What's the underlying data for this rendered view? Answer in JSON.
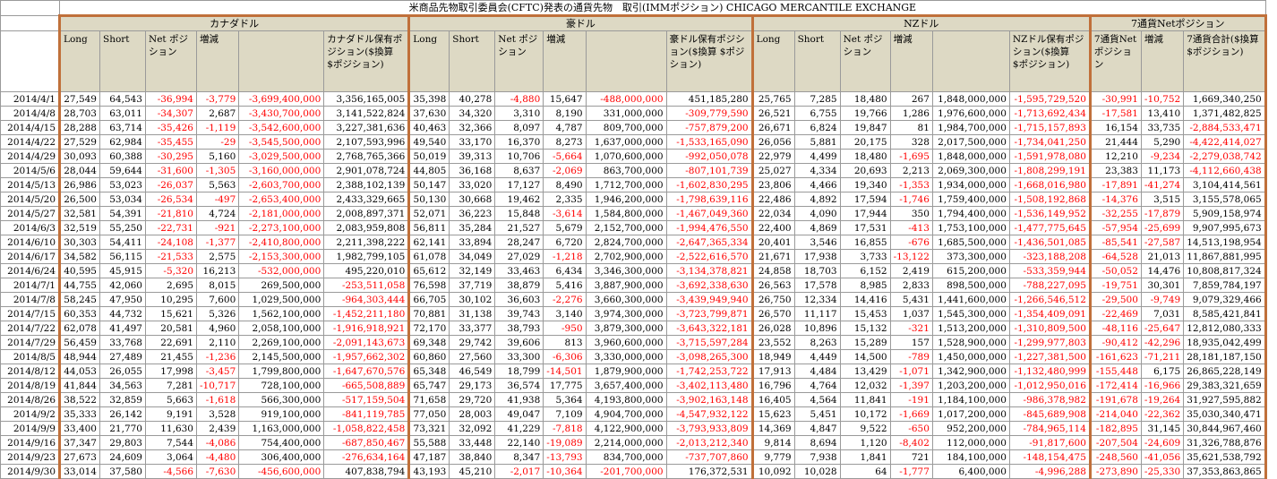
{
  "title": "米商品先物取引委員会(CFTC)発表の通貨先物　取引(IMMポジション) CHICAGO MERCANTILE EXCHANGE",
  "groups": {
    "cad": "カナダドル",
    "aud": "豪ドル",
    "nzd": "NZドル",
    "net7": "7通貨Netポジション"
  },
  "headers": {
    "cad": [
      "Long",
      "Short",
      "Net ポジション",
      "増減",
      "",
      "カナダドル保有ポジション($換算 $ポジション)"
    ],
    "aud": [
      "Long",
      "Short",
      "Net ポジション",
      "増減",
      "",
      "豪ドル保有ポジション($換算 $ポジション)"
    ],
    "nzd": [
      "Long",
      "Short",
      "Net ポジション",
      "増減",
      "",
      "NZドル保有ポジション($換算 $ポジション)"
    ],
    "net7": [
      "7通貨Net ポジション",
      "増減",
      "7通貨合計($換算 $ポジション)"
    ]
  },
  "colors": {
    "header_bg": "#ddd9c4",
    "negative": "#ff0000",
    "separator": "#c0703a"
  },
  "rows": [
    [
      "2014/4/1",
      "27,549",
      "64,543",
      "-36,994",
      "-3,779",
      "-3,699,400,000",
      "3,356,165,005",
      "35,398",
      "40,278",
      "-4,880",
      "15,647",
      "-488,000,000",
      "451,185,280",
      "25,765",
      "7,285",
      "18,480",
      "267",
      "1,848,000,000",
      "-1,595,729,520",
      "-30,991",
      "-10,752",
      "1,669,340,250"
    ],
    [
      "2014/4/8",
      "28,703",
      "63,011",
      "-34,307",
      "2,687",
      "-3,430,700,000",
      "3,141,522,824",
      "37,630",
      "34,320",
      "3,310",
      "8,190",
      "331,000,000",
      "-309,779,590",
      "26,521",
      "6,755",
      "19,766",
      "1,286",
      "1,976,600,000",
      "-1,713,692,434",
      "-17,581",
      "13,410",
      "1,371,482,825"
    ],
    [
      "2014/4/15",
      "28,288",
      "63,714",
      "-35,426",
      "-1,119",
      "-3,542,600,000",
      "3,227,381,636",
      "40,463",
      "32,366",
      "8,097",
      "4,787",
      "809,700,000",
      "-757,879,200",
      "26,671",
      "6,824",
      "19,847",
      "81",
      "1,984,700,000",
      "-1,715,157,893",
      "16,154",
      "33,735",
      "-2,884,533,471"
    ],
    [
      "2014/4/22",
      "27,529",
      "62,984",
      "-35,455",
      "-29",
      "-3,545,500,000",
      "2,107,593,996",
      "49,540",
      "33,170",
      "16,370",
      "8,273",
      "1,637,000,000",
      "-1,533,165,090",
      "26,056",
      "5,881",
      "20,175",
      "328",
      "2,017,500,000",
      "-1,734,041,250",
      "21,444",
      "5,290",
      "-4,422,414,027"
    ],
    [
      "2014/4/29",
      "30,093",
      "60,388",
      "-30,295",
      "5,160",
      "-3,029,500,000",
      "2,768,765,366",
      "50,019",
      "39,313",
      "10,706",
      "-5,664",
      "1,070,600,000",
      "-992,050,078",
      "22,979",
      "4,499",
      "18,480",
      "-1,695",
      "1,848,000,000",
      "-1,591,978,080",
      "12,210",
      "-9,234",
      "-2,279,038,742"
    ],
    [
      "2014/5/6",
      "28,044",
      "59,644",
      "-31,600",
      "-1,305",
      "-3,160,000,000",
      "2,901,078,724",
      "44,805",
      "36,168",
      "8,637",
      "-2,069",
      "863,700,000",
      "-807,101,739",
      "25,027",
      "4,334",
      "20,693",
      "2,213",
      "2,069,300,000",
      "-1,808,299,191",
      "23,383",
      "11,173",
      "-4,112,660,438"
    ],
    [
      "2014/5/13",
      "26,986",
      "53,023",
      "-26,037",
      "5,563",
      "-2,603,700,000",
      "2,388,102,139",
      "50,147",
      "33,020",
      "17,127",
      "8,490",
      "1,712,700,000",
      "-1,602,830,295",
      "23,806",
      "4,466",
      "19,340",
      "-1,353",
      "1,934,000,000",
      "-1,668,016,980",
      "-17,891",
      "-41,274",
      "3,104,414,561"
    ],
    [
      "2014/5/20",
      "26,500",
      "53,034",
      "-26,534",
      "-497",
      "-2,653,400,000",
      "2,433,329,665",
      "50,130",
      "30,668",
      "19,462",
      "2,335",
      "1,946,200,000",
      "-1,798,639,116",
      "22,486",
      "4,892",
      "17,594",
      "-1,746",
      "1,759,400,000",
      "-1,508,192,868",
      "-14,376",
      "3,515",
      "3,155,578,065"
    ],
    [
      "2014/5/27",
      "32,581",
      "54,391",
      "-21,810",
      "4,724",
      "-2,181,000,000",
      "2,008,897,371",
      "52,071",
      "36,223",
      "15,848",
      "-3,614",
      "1,584,800,000",
      "-1,467,049,360",
      "22,034",
      "4,090",
      "17,944",
      "350",
      "1,794,400,000",
      "-1,536,149,952",
      "-32,255",
      "-17,879",
      "5,909,158,974"
    ],
    [
      "2014/6/3",
      "32,519",
      "55,250",
      "-22,731",
      "-921",
      "-2,273,100,000",
      "2,083,959,808",
      "56,811",
      "35,284",
      "21,527",
      "5,679",
      "2,152,700,000",
      "-1,994,476,550",
      "22,400",
      "4,869",
      "17,531",
      "-413",
      "1,753,100,000",
      "-1,477,775,645",
      "-57,954",
      "-25,699",
      "9,907,995,673"
    ],
    [
      "2014/6/10",
      "30,303",
      "54,411",
      "-24,108",
      "-1,377",
      "-2,410,800,000",
      "2,211,398,222",
      "62,141",
      "33,894",
      "28,247",
      "6,720",
      "2,824,700,000",
      "-2,647,365,334",
      "20,401",
      "3,546",
      "16,855",
      "-676",
      "1,685,500,000",
      "-1,436,501,085",
      "-85,541",
      "-27,587",
      "14,513,198,954"
    ],
    [
      "2014/6/17",
      "34,582",
      "56,115",
      "-21,533",
      "2,575",
      "-2,153,300,000",
      "1,982,799,105",
      "61,078",
      "34,049",
      "27,029",
      "-1,218",
      "2,702,900,000",
      "-2,522,616,570",
      "21,671",
      "17,938",
      "3,733",
      "-13,122",
      "373,300,000",
      "-323,188,208",
      "-64,528",
      "21,013",
      "11,867,881,995"
    ],
    [
      "2014/6/24",
      "40,595",
      "45,915",
      "-5,320",
      "16,213",
      "-532,000,000",
      "495,220,010",
      "65,612",
      "32,149",
      "33,463",
      "6,434",
      "3,346,300,000",
      "-3,134,378,821",
      "24,858",
      "18,703",
      "6,152",
      "2,419",
      "615,200,000",
      "-533,359,944",
      "-50,052",
      "14,476",
      "10,808,817,324"
    ],
    [
      "2014/7/1",
      "44,755",
      "42,060",
      "2,695",
      "8,015",
      "269,500,000",
      "-253,511,058",
      "76,598",
      "37,719",
      "38,879",
      "5,416",
      "3,887,900,000",
      "-3,692,338,630",
      "26,563",
      "17,578",
      "8,985",
      "2,833",
      "898,500,000",
      "-788,227,095",
      "-19,751",
      "30,301",
      "7,859,784,197"
    ],
    [
      "2014/7/8",
      "58,245",
      "47,950",
      "10,295",
      "7,600",
      "1,029,500,000",
      "-964,303,444",
      "66,705",
      "30,102",
      "36,603",
      "-2,276",
      "3,660,300,000",
      "-3,439,949,940",
      "26,750",
      "12,334",
      "14,416",
      "5,431",
      "1,441,600,000",
      "-1,266,546,512",
      "-29,500",
      "-9,749",
      "9,079,329,466"
    ],
    [
      "2014/7/15",
      "60,353",
      "44,732",
      "15,621",
      "5,326",
      "1,562,100,000",
      "-1,452,211,180",
      "70,881",
      "31,138",
      "39,743",
      "3,140",
      "3,974,300,000",
      "-3,723,799,871",
      "26,570",
      "11,117",
      "15,453",
      "1,037",
      "1,545,300,000",
      "-1,354,409,091",
      "-22,469",
      "7,031",
      "8,585,421,841"
    ],
    [
      "2014/7/22",
      "62,078",
      "41,497",
      "20,581",
      "4,960",
      "2,058,100,000",
      "-1,916,918,921",
      "72,170",
      "33,377",
      "38,793",
      "-950",
      "3,879,300,000",
      "-3,643,322,181",
      "26,028",
      "10,896",
      "15,132",
      "-321",
      "1,513,200,000",
      "-1,310,809,500",
      "-48,116",
      "-25,647",
      "12,812,080,333"
    ],
    [
      "2014/7/29",
      "56,459",
      "33,768",
      "22,691",
      "2,110",
      "2,269,100,000",
      "-2,091,143,673",
      "69,348",
      "29,742",
      "39,606",
      "813",
      "3,960,600,000",
      "-3,715,597,284",
      "23,552",
      "8,263",
      "15,289",
      "157",
      "1,528,900,000",
      "-1,299,977,803",
      "-90,412",
      "-42,296",
      "18,935,042,499"
    ],
    [
      "2014/8/5",
      "48,944",
      "27,489",
      "21,455",
      "-1,236",
      "2,145,500,000",
      "-1,957,662,302",
      "60,860",
      "27,560",
      "33,300",
      "-6,306",
      "3,330,000,000",
      "-3,098,265,300",
      "18,949",
      "4,449",
      "14,500",
      "-789",
      "1,450,000,000",
      "-1,227,381,500",
      "-161,623",
      "-71,211",
      "28,181,187,150"
    ],
    [
      "2014/8/12",
      "44,053",
      "26,055",
      "17,998",
      "-3,457",
      "1,799,800,000",
      "-1,647,670,576",
      "65,348",
      "46,549",
      "18,799",
      "-14,501",
      "1,879,900,000",
      "-1,742,253,722",
      "17,913",
      "4,484",
      "13,429",
      "-1,071",
      "1,342,900,000",
      "-1,132,480,999",
      "-155,448",
      "6,175",
      "26,865,228,149"
    ],
    [
      "2014/8/19",
      "41,844",
      "34,563",
      "7,281",
      "-10,717",
      "728,100,000",
      "-665,508,889",
      "65,747",
      "29,173",
      "36,574",
      "17,775",
      "3,657,400,000",
      "-3,402,113,480",
      "16,796",
      "4,764",
      "12,032",
      "-1,397",
      "1,203,200,000",
      "-1,012,950,016",
      "-172,414",
      "-16,966",
      "29,383,321,659"
    ],
    [
      "2014/8/26",
      "38,522",
      "32,859",
      "5,663",
      "-1,618",
      "566,300,000",
      "-517,159,504",
      "71,658",
      "29,720",
      "41,938",
      "5,364",
      "4,193,800,000",
      "-3,902,163,148",
      "16,405",
      "4,564",
      "11,841",
      "-191",
      "1,184,100,000",
      "-986,378,982",
      "-191,678",
      "-19,264",
      "31,927,595,882"
    ],
    [
      "2014/9/2",
      "35,333",
      "26,142",
      "9,191",
      "3,528",
      "919,100,000",
      "-841,119,785",
      "77,050",
      "28,003",
      "49,047",
      "7,109",
      "4,904,700,000",
      "-4,547,932,122",
      "15,623",
      "5,451",
      "10,172",
      "-1,669",
      "1,017,200,000",
      "-845,689,908",
      "-214,040",
      "-22,362",
      "35,030,340,471"
    ],
    [
      "2014/9/9",
      "33,400",
      "21,770",
      "11,630",
      "2,439",
      "1,163,000,000",
      "-1,058,822,458",
      "73,321",
      "32,092",
      "41,229",
      "-7,818",
      "4,122,900,000",
      "-3,793,933,809",
      "14,369",
      "4,847",
      "9,522",
      "-650",
      "952,200,000",
      "-784,965,114",
      "-182,895",
      "31,145",
      "30,844,967,460"
    ],
    [
      "2014/9/16",
      "37,347",
      "29,803",
      "7,544",
      "-4,086",
      "754,400,000",
      "-687,850,467",
      "55,588",
      "33,448",
      "22,140",
      "-19,089",
      "2,214,000,000",
      "-2,013,212,340",
      "9,814",
      "8,694",
      "1,120",
      "-8,402",
      "112,000,000",
      "-91,817,600",
      "-207,504",
      "-24,609",
      "31,326,788,876"
    ],
    [
      "2014/9/23",
      "27,673",
      "24,609",
      "3,064",
      "-4,480",
      "306,400,000",
      "-276,634,164",
      "47,187",
      "38,840",
      "8,347",
      "-13,793",
      "834,700,000",
      "-737,707,860",
      "9,779",
      "7,938",
      "1,841",
      "721",
      "184,100,000",
      "-148,154,475",
      "-248,560",
      "-41,056",
      "35,621,538,792"
    ],
    [
      "2014/9/30",
      "33,014",
      "37,580",
      "-4,566",
      "-7,630",
      "-456,600,000",
      "407,838,794",
      "43,193",
      "45,210",
      "-2,017",
      "-10,364",
      "-201,700,000",
      "176,372,531",
      "10,092",
      "10,028",
      "64",
      "-1,777",
      "6,400,000",
      "-4,996,288",
      "-273,890",
      "-25,330",
      "37,353,863,865"
    ]
  ]
}
